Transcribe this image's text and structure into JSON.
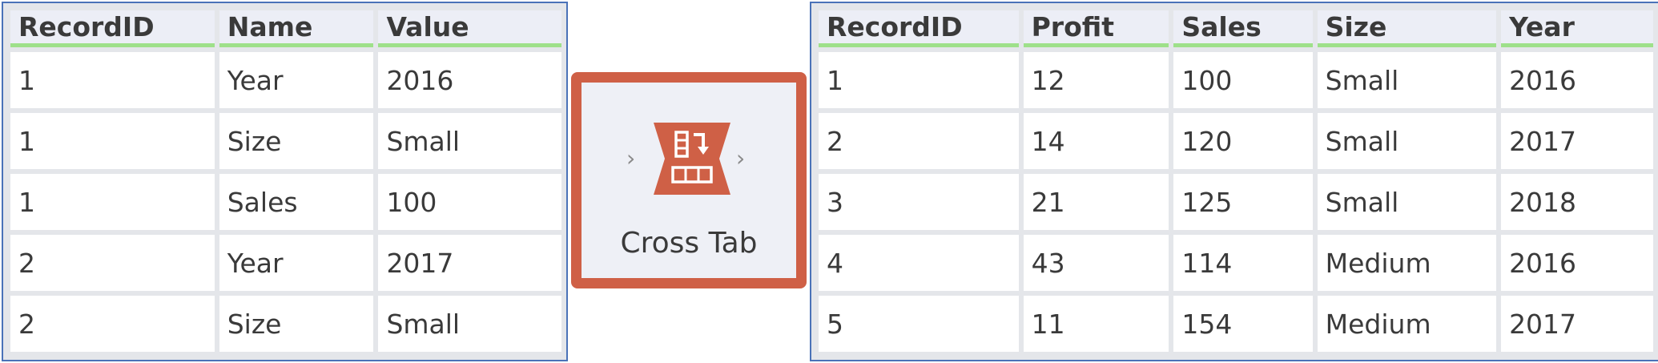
{
  "input_grid": {
    "columns": [
      "RecordID",
      "Name",
      "Value"
    ],
    "rows": [
      [
        "1",
        "Year",
        "2016"
      ],
      [
        "1",
        "Size",
        "Small"
      ],
      [
        "1",
        "Sales",
        "100"
      ],
      [
        "2",
        "Year",
        "2017"
      ],
      [
        "2",
        "Size",
        "Small"
      ]
    ]
  },
  "tool": {
    "label": "Cross Tab",
    "icon": "cross-tab-icon",
    "accent_color": "#cf6046"
  },
  "output_grid": {
    "columns": [
      "RecordID",
      "Profit",
      "Sales",
      "Size",
      "Year"
    ],
    "rows": [
      [
        "1",
        "12",
        "100",
        "Small",
        "2016"
      ],
      [
        "2",
        "14",
        "120",
        "Small",
        "2017"
      ],
      [
        "3",
        "21",
        "125",
        "Small",
        "2018"
      ],
      [
        "4",
        "43",
        "114",
        "Medium",
        "2016"
      ],
      [
        "5",
        "11",
        "154",
        "Medium",
        "2017"
      ]
    ]
  },
  "colors": {
    "grid_border": "#4a72b8",
    "header_underline": "#9ee08a",
    "tool_frame": "#cf6046"
  }
}
